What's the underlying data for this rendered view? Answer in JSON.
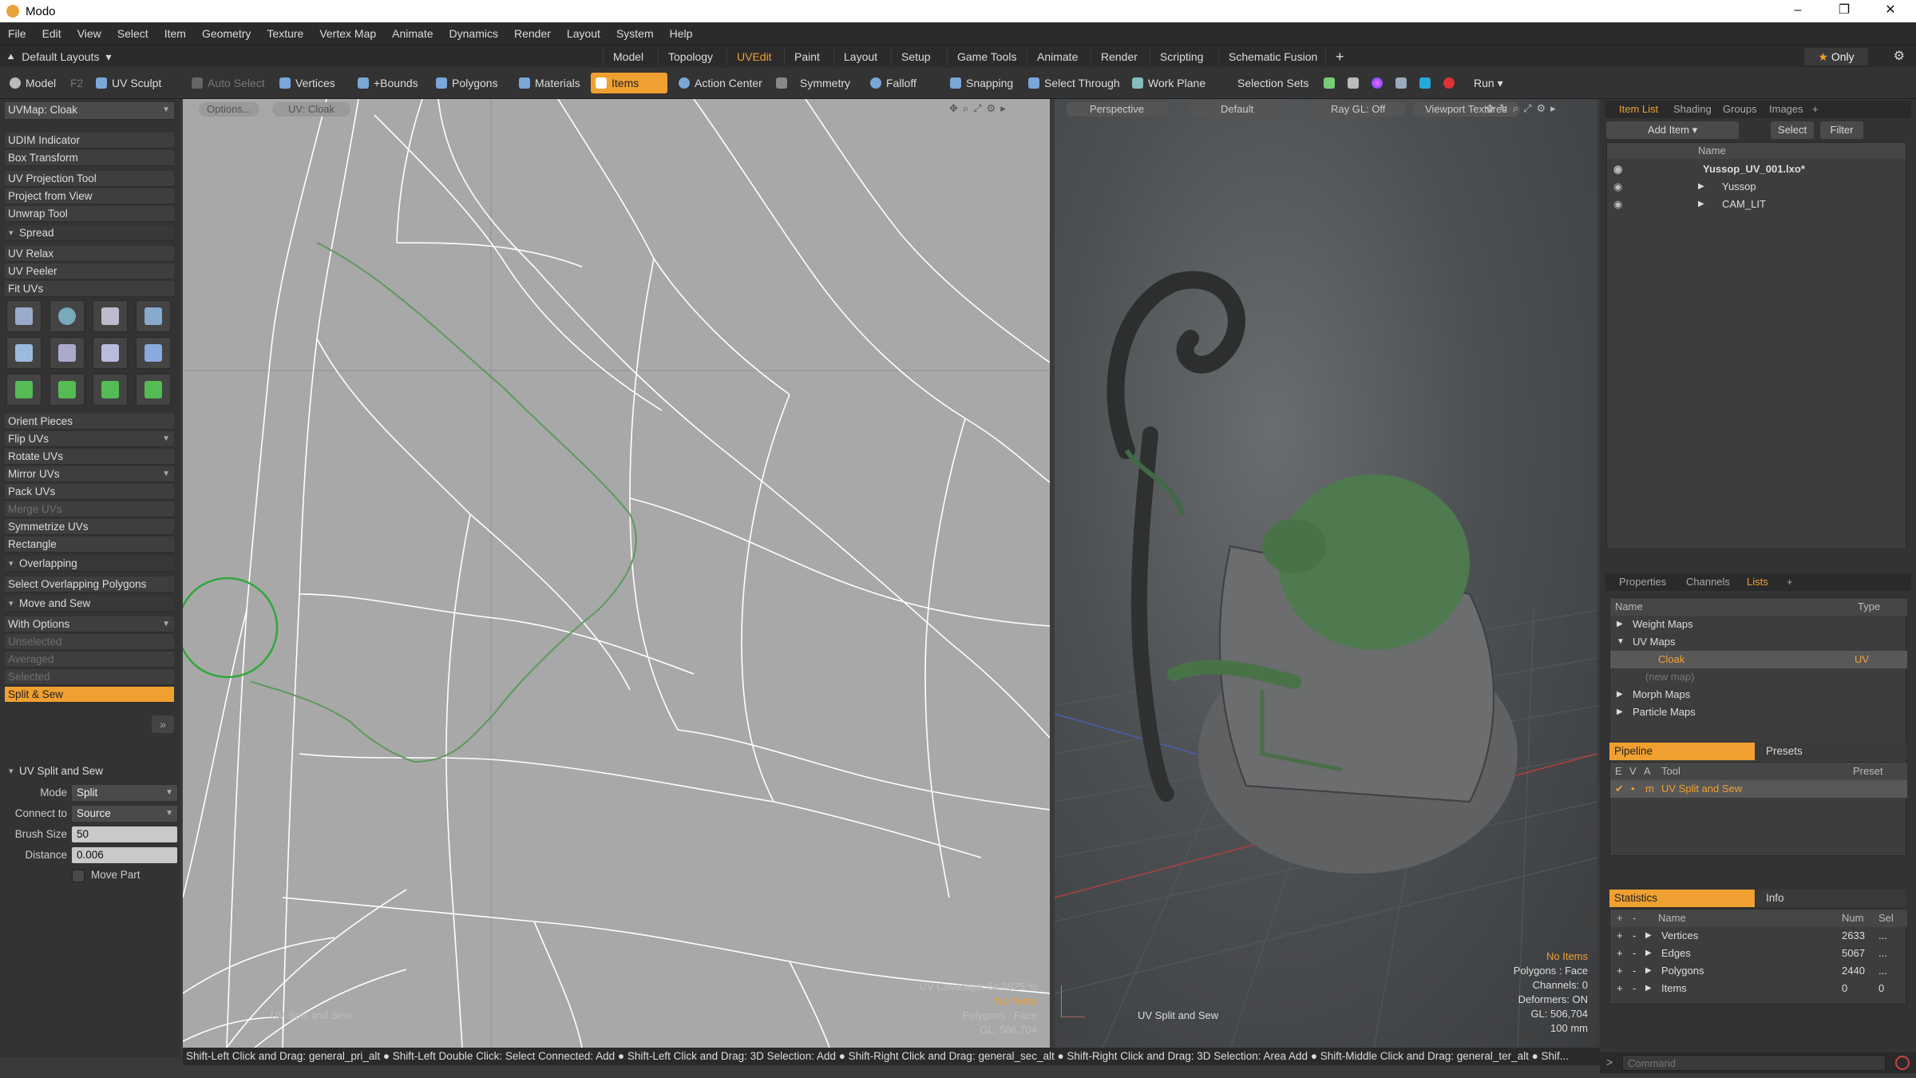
{
  "window": {
    "title": "Modo",
    "controls": [
      "–",
      "❐",
      "✕"
    ]
  },
  "menu": [
    "File",
    "Edit",
    "View",
    "Select",
    "Item",
    "Geometry",
    "Texture",
    "Vertex Map",
    "Animate",
    "Dynamics",
    "Render",
    "Layout",
    "System",
    "Help"
  ],
  "layouts": {
    "preset": "Default Layouts",
    "tabs": [
      "Model",
      "Topology",
      "UVEdit",
      "Paint",
      "Layout",
      "Setup",
      "Game Tools",
      "Animate",
      "Render",
      "Scripting",
      "Schematic Fusion",
      "+"
    ],
    "active": "UVEdit",
    "only_label": "Only"
  },
  "toolbar": {
    "model": "Model",
    "f2": "F2",
    "uv_sculpt": "UV Sculpt",
    "auto_select": "Auto Select",
    "vertices": "Vertices",
    "bounds": "+Bounds",
    "polygons": "Polygons",
    "materials": "Materials",
    "items": "Items",
    "action_center": "Action Center",
    "symmetry": "Symmetry",
    "falloff": "Falloff",
    "snapping": "Snapping",
    "select_through": "Select Through",
    "work_plane": "Work Plane",
    "selection_sets": "Selection Sets",
    "run": "Run"
  },
  "left": {
    "uvmap": "UVMap: Cloak",
    "tools_a": [
      "UDIM Indicator",
      "Box Transform",
      "UV Projection Tool",
      "Project from View",
      "Unwrap Tool"
    ],
    "spread": "Spread",
    "tools_b": [
      "UV Relax",
      "UV Peeler",
      "Fit UVs"
    ],
    "tools_c": [
      "Orient Pieces",
      "Flip UVs",
      "Rotate UVs",
      "Mirror UVs",
      "Pack UVs",
      "Merge UVs",
      "Symmetrize UVs",
      "Rectangle"
    ],
    "overlapping": "Overlapping",
    "select_overlap": "Select Overlapping Polygons",
    "move_sew": "Move and Sew",
    "with_options": "With Options",
    "unselected": "Unselected",
    "averaged": "Averaged",
    "selected": "Selected",
    "split_sew": "Split & Sew",
    "props_title": "UV Split and Sew",
    "mode_label": "Mode",
    "mode_value": "Split",
    "connect_label": "Connect to",
    "connect_value": "Source",
    "brush_label": "Brush Size",
    "brush_value": "50",
    "distance_label": "Distance",
    "distance_value": "0.006",
    "move_part": "Move Part"
  },
  "uvview": {
    "options": "Options...",
    "uvmap": "UV: Cloak",
    "coverage": "UV Coverage: 64.2925 %",
    "no_items": "No Items",
    "polygons": "Polygons : Face",
    "gl": "GL: 506,704",
    "tool": "UV Split and Sew"
  },
  "view3d": {
    "perspective": "Perspective",
    "default": "Default",
    "raygl": "Ray GL: Off",
    "textures": "Viewport Textures",
    "no_items": "No Items",
    "polygons": "Polygons : Face",
    "channels": "Channels: 0",
    "deformers": "Deformers: ON",
    "gl": "GL: 506,704",
    "scale": "100 mm",
    "tool": "UV Split and Sew"
  },
  "itemlist": {
    "tabs": [
      "Item List",
      "Shading",
      "Groups",
      "Images",
      "+"
    ],
    "add_item": "Add Item",
    "select": "Select",
    "filter": "Filter",
    "col_name": "Name",
    "items": [
      "Yussop_UV_001.lxo*",
      "Yussop",
      "CAM_LIT"
    ]
  },
  "props": {
    "tabs": [
      "Properties",
      "Channels",
      "Lists",
      "+"
    ],
    "col_name": "Name",
    "col_type": "Type",
    "rows": [
      {
        "name": "Weight Maps",
        "type": ""
      },
      {
        "name": "UV Maps",
        "type": ""
      },
      {
        "name": "Cloak",
        "type": "UV"
      },
      {
        "name": "(new map)",
        "type": ""
      },
      {
        "name": "Morph Maps",
        "type": ""
      },
      {
        "name": "Particle Maps",
        "type": ""
      }
    ]
  },
  "pipeline": {
    "tab": "Pipeline",
    "presets": "Presets",
    "cols": [
      "E",
      "V",
      "A",
      "Tool",
      "Preset"
    ],
    "row": {
      "a": "m",
      "tool": "UV Split and Sew"
    }
  },
  "stats": {
    "tab": "Statistics",
    "info": "Info",
    "cols": [
      "Name",
      "Num",
      "Sel"
    ],
    "rows": [
      {
        "name": "Vertices",
        "num": "2633",
        "sel": "..."
      },
      {
        "name": "Edges",
        "num": "5067",
        "sel": "..."
      },
      {
        "name": "Polygons",
        "num": "2440",
        "sel": "..."
      },
      {
        "name": "Items",
        "num": "0",
        "sel": "0"
      }
    ]
  },
  "status": "Shift-Left Click and Drag: general_pri_alt ● Shift-Left Double Click: Select Connected: Add ● Shift-Left Click and Drag: 3D Selection: Add ● Shift-Right Click and Drag: general_sec_alt ● Shift-Right Click and Drag: 3D Selection: Area Add ● Shift-Middle Click and Drag: general_ter_alt ● Shif...",
  "command_placeholder": "Command",
  "colors": {
    "accent": "#f0a030",
    "uv_bg": "#a8a8a8",
    "mesh_green": "#4f7a50"
  }
}
